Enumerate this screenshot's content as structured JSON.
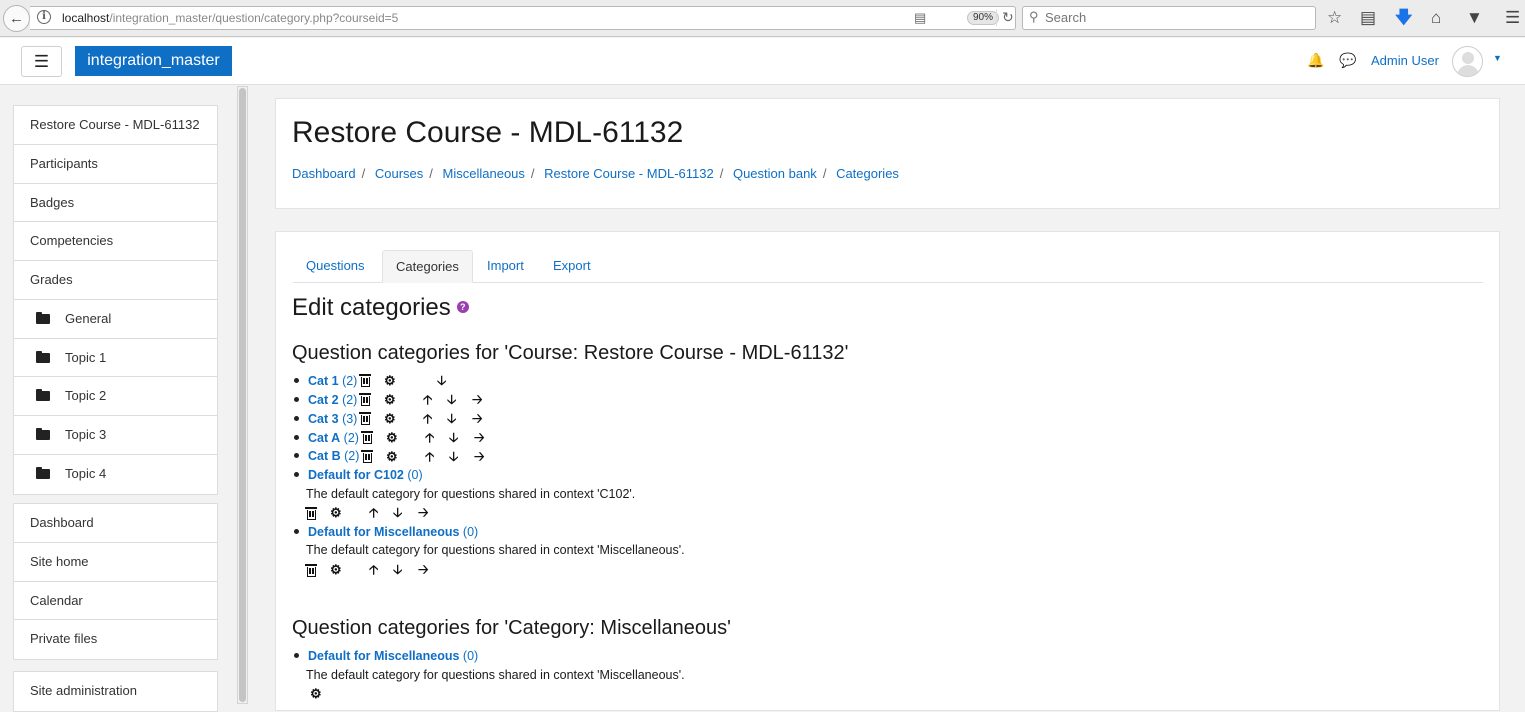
{
  "browser": {
    "url_host": "localhost",
    "url_path": "/integration_master/question/category.php?courseid=5",
    "zoom": "90%",
    "search_placeholder": "Search"
  },
  "topbar": {
    "brand": "integration_master",
    "user_name": "Admin User"
  },
  "drawer": {
    "course_items": [
      "Restore Course - MDL-61132",
      "Participants",
      "Badges",
      "Competencies",
      "Grades"
    ],
    "sections": [
      "General",
      "Topic 1",
      "Topic 2",
      "Topic 3",
      "Topic 4"
    ],
    "site_items": [
      "Dashboard",
      "Site home",
      "Calendar",
      "Private files"
    ],
    "admin_items": [
      "Site administration"
    ]
  },
  "header": {
    "title": "Restore Course - MDL-61132",
    "breadcrumb": [
      "Dashboard",
      "Courses",
      "Miscellaneous",
      "Restore Course - MDL-61132",
      "Question bank",
      "Categories"
    ]
  },
  "tabs": [
    "Questions",
    "Categories",
    "Import",
    "Export"
  ],
  "active_tab": "Categories",
  "main": {
    "heading": "Edit categories",
    "course_section_title": "Question categories for 'Course: Restore Course - MDL-61132'",
    "course_categories": [
      {
        "name": "Cat 1",
        "count": "(2)"
      },
      {
        "name": "Cat 2",
        "count": "(2)"
      },
      {
        "name": "Cat 3",
        "count": "(3)"
      },
      {
        "name": "Cat A",
        "count": "(2)"
      },
      {
        "name": "Cat B",
        "count": "(2)"
      },
      {
        "name": "Default for C102",
        "count": "(0)",
        "description": "The default category for questions shared in context 'C102'."
      },
      {
        "name": "Default for Miscellaneous",
        "count": "(0)",
        "description": "The default category for questions shared in context 'Miscellaneous'."
      }
    ],
    "misc_section_title": "Question categories for 'Category: Miscellaneous'",
    "misc_categories": [
      {
        "name": "Default for Miscellaneous",
        "count": "(0)",
        "description": "The default category for questions shared in context 'Miscellaneous'."
      }
    ]
  }
}
